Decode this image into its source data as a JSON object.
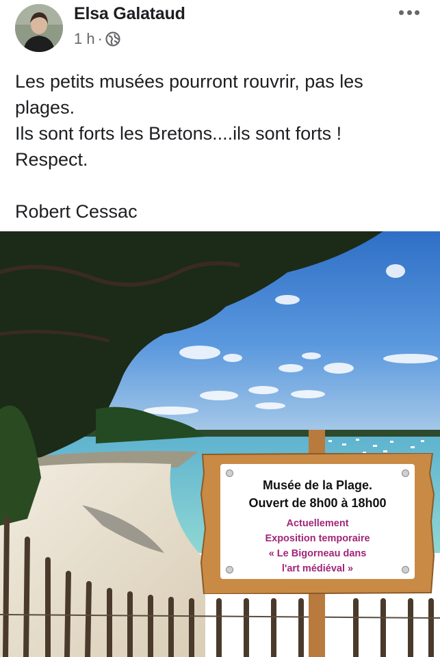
{
  "post": {
    "author": "Elsa Galataud",
    "time": "1 h",
    "separator": "·",
    "privacy_icon": "globe-icon",
    "more_icon": "more-dots-icon",
    "text_lines": [
      "Les petits musées pourront rouvrir, pas les",
      "plages.",
      "Ils sont forts les Bretons....ils sont forts !",
      "Respect.",
      "",
      "Robert Cessac"
    ]
  },
  "image": {
    "sign": {
      "title_line1": "Musée de la Plage.",
      "title_line2": "Ouvert de 8h00 à 18h00",
      "sub_line1": "Actuellement",
      "sub_line2": "Exposition temporaire",
      "sub_line3": "« Le Bigorneau dans",
      "sub_line4": "l'art médiéval »"
    }
  },
  "colors": {
    "author": "#1c1e21",
    "meta": "#65676b",
    "sign_accent": "#a0257a",
    "sky": "#3d7fd1",
    "sea": "#6cc3cf",
    "sand": "#e9e2d3",
    "wood": "#c98a45"
  }
}
